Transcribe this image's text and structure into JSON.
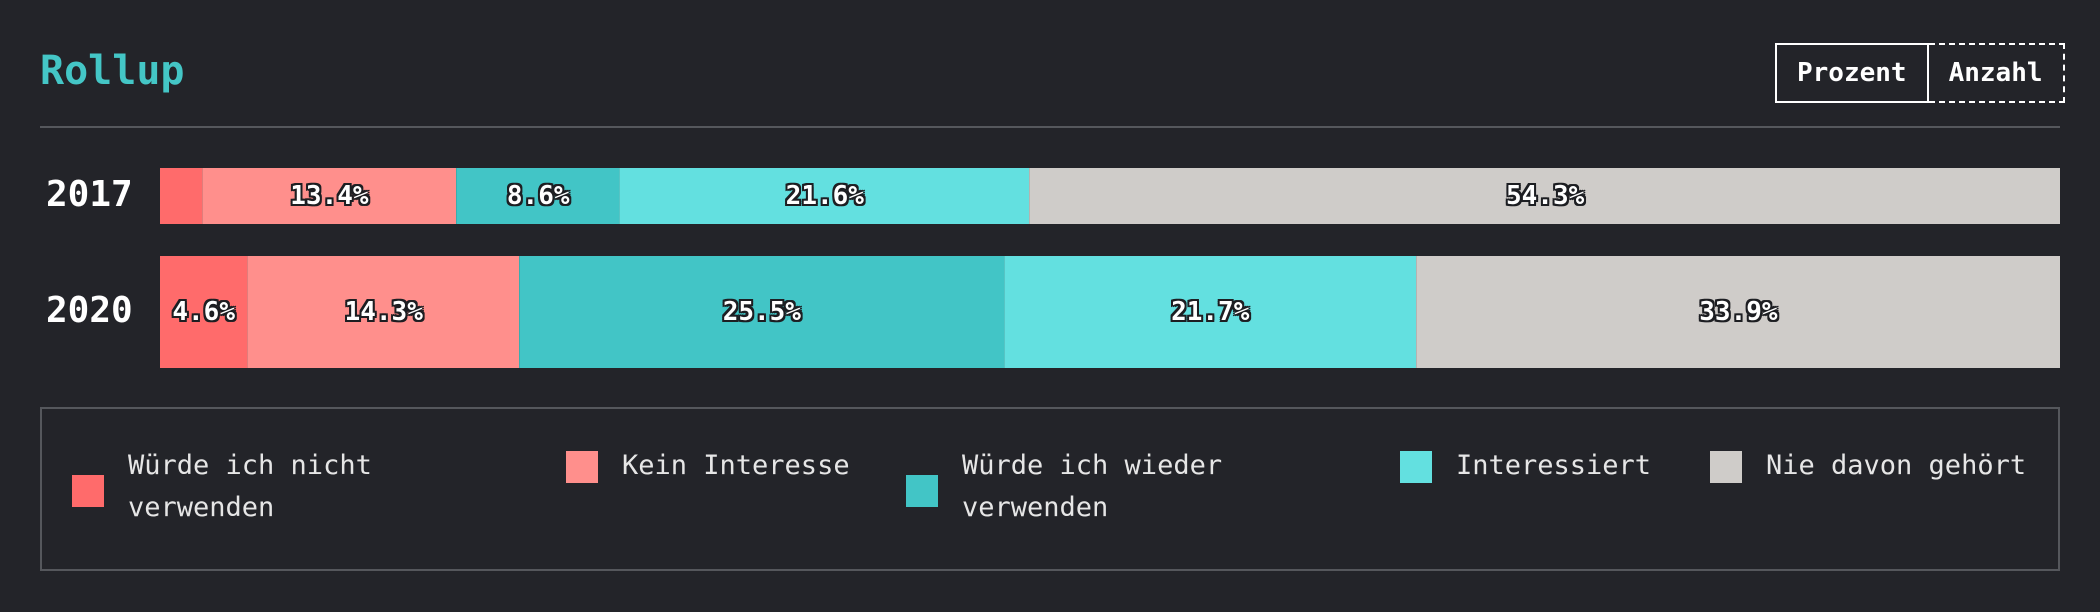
{
  "header": {
    "title": "Rollup",
    "toggle": {
      "percent_label": "Prozent",
      "count_label": "Anzahl",
      "active": "Prozent"
    }
  },
  "colors": {
    "background": "#232429",
    "accent": "#44c6c6",
    "series": [
      "#ff6b6b",
      "#ff8f8c",
      "#42c5c6",
      "#63e0e0",
      "#cfccc9"
    ]
  },
  "chart_data": {
    "type": "bar",
    "orientation": "horizontal",
    "stacked": "percent",
    "title": "Rollup",
    "categories": [
      "2017",
      "2020"
    ],
    "series": [
      {
        "name": "Würde ich nicht verwenden",
        "values": [
          2.2,
          4.6
        ],
        "labels": [
          "",
          "4.6%"
        ]
      },
      {
        "name": "Kein Interesse",
        "values": [
          13.4,
          14.3
        ],
        "labels": [
          "13.4%",
          "14.3%"
        ]
      },
      {
        "name": "Würde ich wieder verwenden",
        "values": [
          8.6,
          25.5
        ],
        "labels": [
          "8.6%",
          "25.5%"
        ]
      },
      {
        "name": "Interessiert",
        "values": [
          21.6,
          21.7
        ],
        "labels": [
          "21.6%",
          "21.7%"
        ]
      },
      {
        "name": "Nie davon gehört",
        "values": [
          54.3,
          33.9
        ],
        "labels": [
          "54.3%",
          "33.9%"
        ]
      }
    ],
    "legend": [
      "Würde ich nicht verwenden",
      "Kein Interesse",
      "Würde ich wieder verwenden",
      "Interessiert",
      "Nie davon gehört"
    ],
    "legend_position": "bottom"
  }
}
